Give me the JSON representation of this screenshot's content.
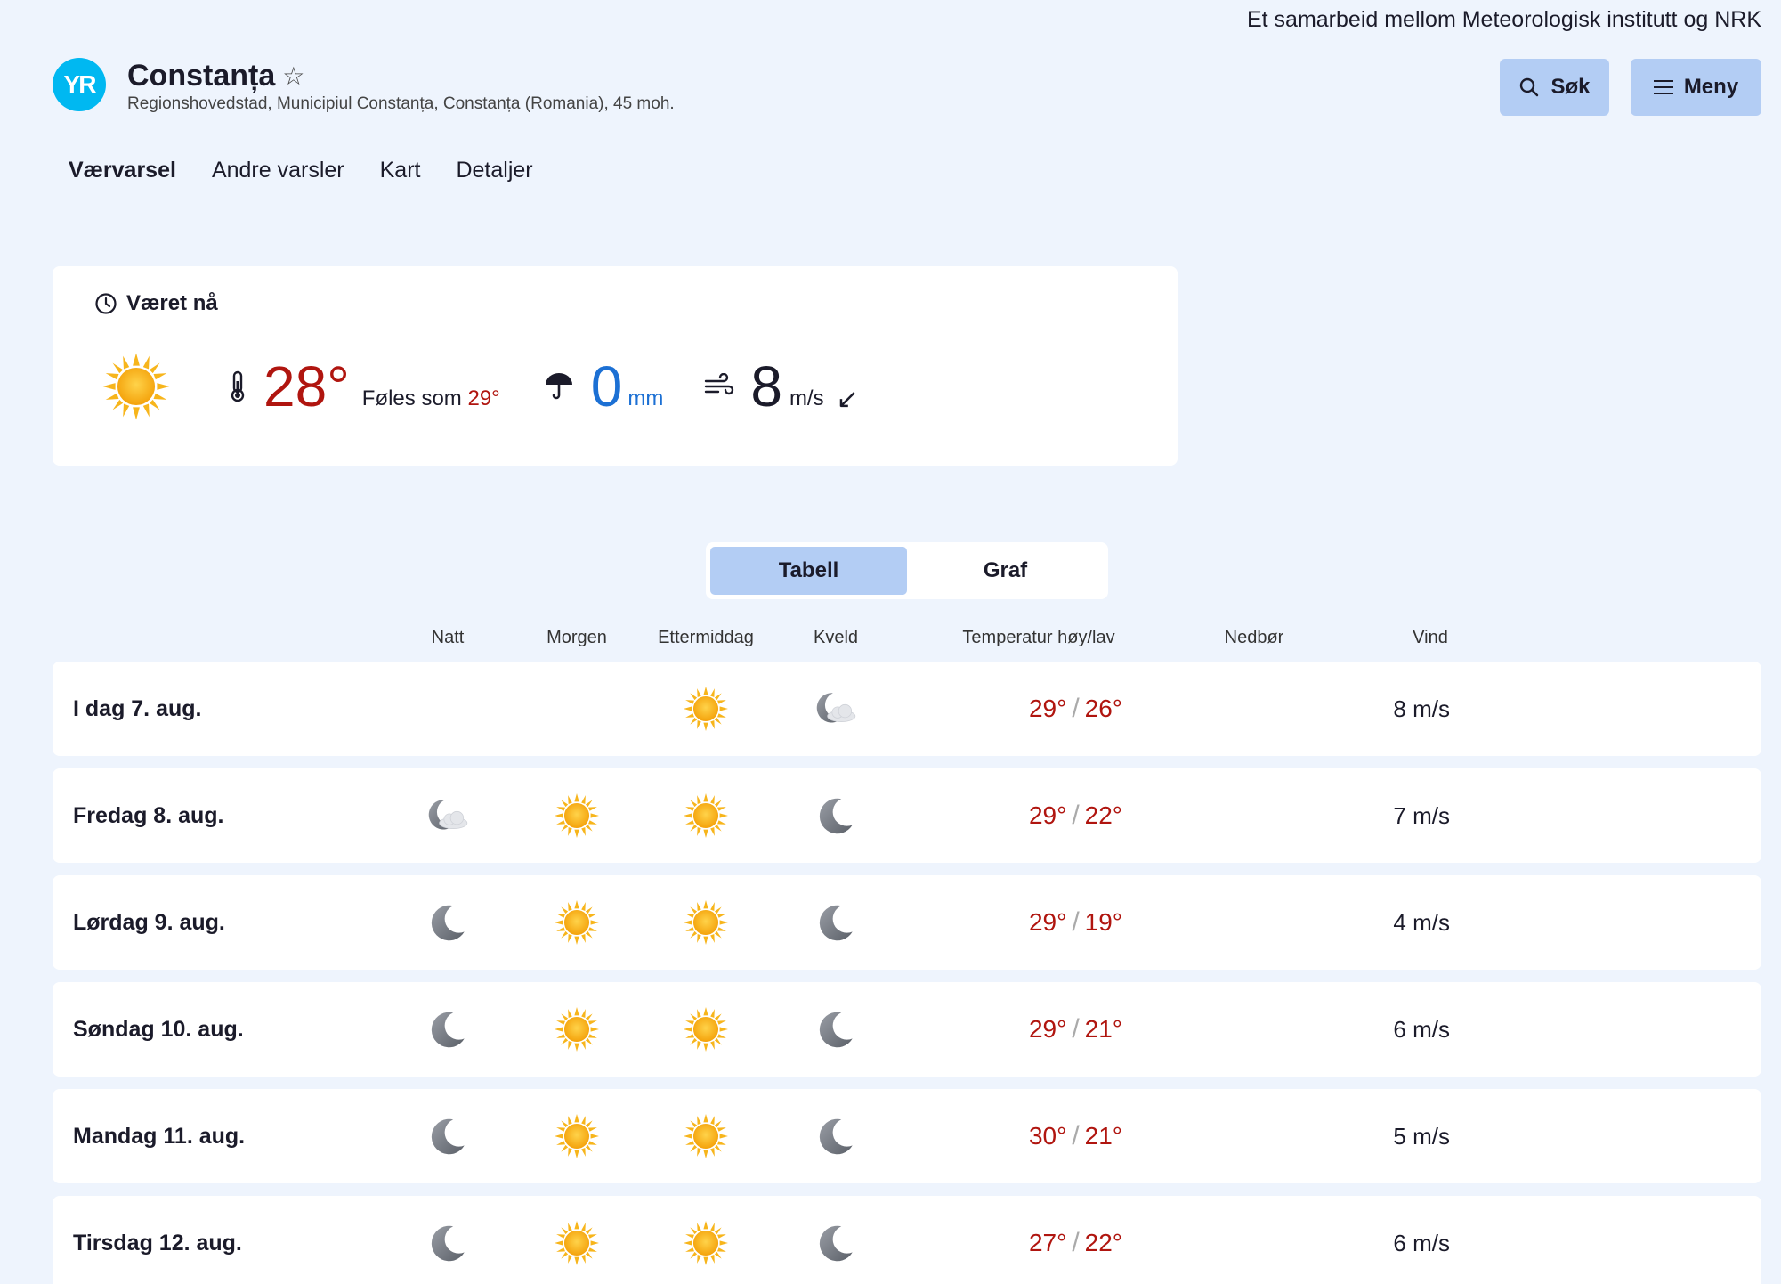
{
  "header": {
    "partner_text": "Et samarbeid mellom Meteorologisk institutt og NRK",
    "logo_text": "YR",
    "location_name": "Constanța",
    "location_subtitle": "Regionshovedstad, Municipiul Constanța, Constanța (Romania), 45 moh.",
    "search_label": "Søk",
    "menu_label": "Meny"
  },
  "nav": {
    "items": [
      {
        "label": "Værvarsel",
        "active": true
      },
      {
        "label": "Andre varsler",
        "active": false
      },
      {
        "label": "Kart",
        "active": false
      },
      {
        "label": "Detaljer",
        "active": false
      }
    ]
  },
  "now": {
    "heading": "Været nå",
    "temperature": "28°",
    "feels_like_label": "Føles som",
    "feels_like_value": "29°",
    "precipitation": "0",
    "precipitation_unit": "mm",
    "wind": "8",
    "wind_unit": "m/s",
    "wind_arrow": "↙"
  },
  "view_toggle": {
    "table_label": "Tabell",
    "graph_label": "Graf",
    "active": "table"
  },
  "table": {
    "headers": {
      "night": "Natt",
      "morning": "Morgen",
      "afternoon": "Ettermiddag",
      "evening": "Kveld",
      "temp": "Temperatur høy/lav",
      "precip": "Nedbør",
      "wind": "Vind"
    },
    "rows": [
      {
        "day": "I dag 7. aug.",
        "night": "",
        "morning": "",
        "afternoon": "sun-icon",
        "evening": "moon-cloud-icon",
        "high": "29°",
        "low": "26°",
        "precip": "",
        "wind": "8 m/s"
      },
      {
        "day": "Fredag 8. aug.",
        "night": "moon-cloud-icon",
        "morning": "sun-icon",
        "afternoon": "sun-icon",
        "evening": "moon-icon",
        "high": "29°",
        "low": "22°",
        "precip": "",
        "wind": "7 m/s"
      },
      {
        "day": "Lørdag 9. aug.",
        "night": "moon-icon",
        "morning": "sun-icon",
        "afternoon": "sun-icon",
        "evening": "moon-icon",
        "high": "29°",
        "low": "19°",
        "precip": "",
        "wind": "4 m/s"
      },
      {
        "day": "Søndag 10. aug.",
        "night": "moon-icon",
        "morning": "sun-icon",
        "afternoon": "sun-icon",
        "evening": "moon-icon",
        "high": "29°",
        "low": "21°",
        "precip": "",
        "wind": "6 m/s"
      },
      {
        "day": "Mandag 11. aug.",
        "night": "moon-icon",
        "morning": "sun-icon",
        "afternoon": "sun-icon",
        "evening": "moon-icon",
        "high": "30°",
        "low": "21°",
        "precip": "",
        "wind": "5 m/s"
      },
      {
        "day": "Tirsdag 12. aug.",
        "night": "moon-icon",
        "morning": "sun-icon",
        "afternoon": "sun-icon",
        "evening": "moon-icon",
        "high": "27°",
        "low": "22°",
        "precip": "",
        "wind": "6 m/s"
      }
    ]
  },
  "colors": {
    "background": "#eef4fd",
    "accent_button": "#b3cdf4",
    "temperature_red": "#b0150f",
    "precip_blue": "#1c70d4",
    "logo_blue": "#00b8f1"
  }
}
